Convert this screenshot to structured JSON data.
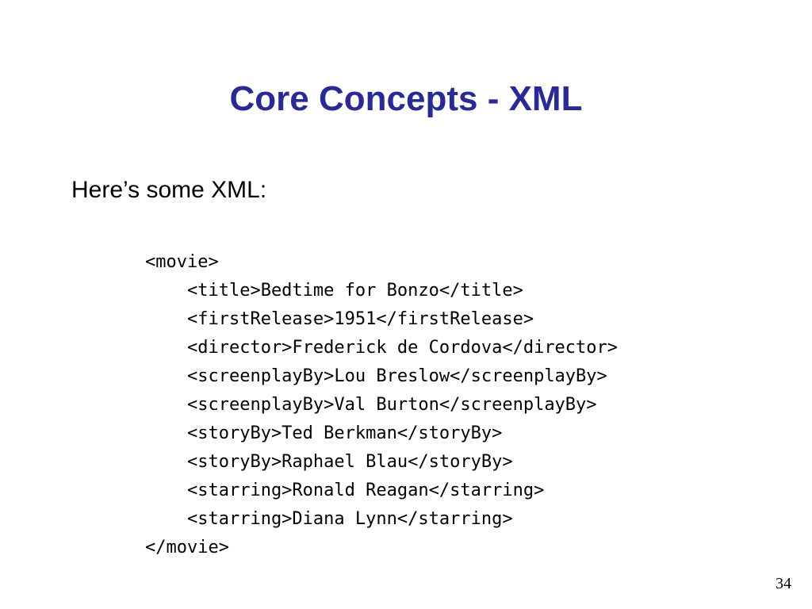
{
  "title": "Core Concepts - XML",
  "intro": "Here’s some XML:",
  "code": "<movie>\n    <title>Bedtime for Bonzo</title>\n    <firstRelease>1951</firstRelease>\n    <director>Frederick de Cordova</director>\n    <screenplayBy>Lou Breslow</screenplayBy>\n    <screenplayBy>Val Burton</screenplayBy>\n    <storyBy>Ted Berkman</storyBy>\n    <storyBy>Raphael Blau</storyBy>\n    <starring>Ronald Reagan</starring>\n    <starring>Diana Lynn</starring>\n</movie>",
  "page_number": "34"
}
